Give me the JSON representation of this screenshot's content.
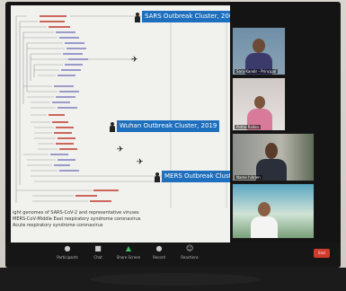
{
  "clusters": {
    "sars": "SARS Outbreak Cluster, 2002",
    "wuhan": "Wuhan Outbreak Cluster, 2019",
    "mers": "MERS Outbreak Clust"
  },
  "caption_lines": [
    "ight genomes of SARS-CoV-2 and representative viruses",
    "MERS-CoV-Middle East respiratory syndrome coronavirus",
    "Acute respiratory syndrome coronavirus"
  ],
  "participants": [
    {
      "name": "Sara Kandir - Principal"
    },
    {
      "name": "Pattie Rallon"
    },
    {
      "name": "Name hidden"
    },
    {
      "name": ""
    }
  ],
  "toolbar": {
    "items": [
      {
        "icon": "microphone-icon",
        "label": "Participants"
      },
      {
        "icon": "chat-icon",
        "label": "Chat"
      },
      {
        "icon": "share-screen-icon",
        "label": "Share Screen"
      },
      {
        "icon": "record-icon",
        "label": "Record"
      },
      {
        "icon": "reactions-icon",
        "label": "Reactions"
      }
    ],
    "end_label": "End"
  },
  "colors": {
    "cluster_label": "#1e6fbd",
    "end_button": "#d23a2c",
    "toolbar_bg": "#161616"
  }
}
